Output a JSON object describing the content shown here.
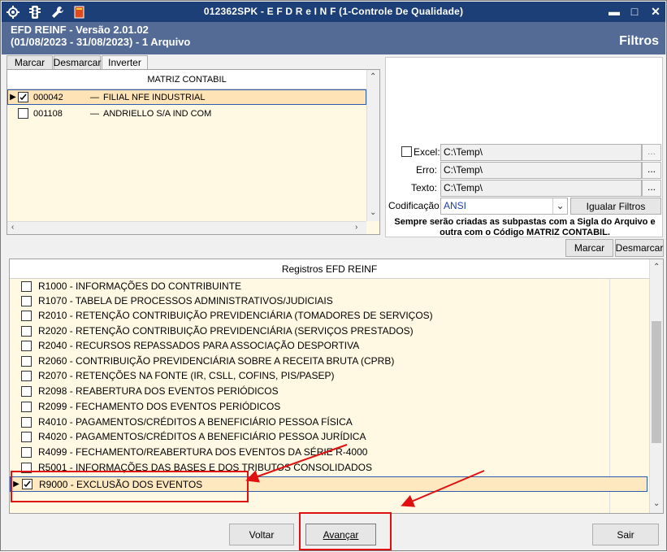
{
  "window": {
    "title": "012362SPK - E F D   R e I N F (1-Controle De Qualidade)",
    "minimize": "▬",
    "maximize": "□",
    "close": "✕"
  },
  "header": {
    "line1": "EFD REINF - Versão 2.01.02",
    "line2": "(01/08/2023 - 31/08/2023) - 1 Arquivo",
    "filtros": "Filtros"
  },
  "top_toolbar": {
    "marcar": "Marcar",
    "desmarcar": "Desmarcar",
    "inverter": "Inverter"
  },
  "matriz_grid": {
    "header": "MATRIZ CONTABIL",
    "rows": [
      {
        "checked": true,
        "code": "000042",
        "dash": "—",
        "name": "FILIAL NFE INDUSTRIAL",
        "selected": true
      },
      {
        "checked": false,
        "code": "001108",
        "dash": "—",
        "name": "ANDRIELLO S/A IND COM",
        "selected": false
      }
    ]
  },
  "settings": {
    "excel_label": "Excel:",
    "excel_value": "C:\\Temp\\",
    "excel_checked": false,
    "erro_label": "Erro:",
    "erro_value": "C:\\Temp\\",
    "texto_label": "Texto:",
    "texto_value": "C:\\Temp\\",
    "codificacao_label": "Codificação:",
    "codificacao_value": "ANSI",
    "ellipsis": "...",
    "igualar": "Igualar Filtros",
    "note_line1": "Sempre serão criadas as subpastas com a Sigla do Arquivo e",
    "note_line2": "outra com o Código MATRIZ CONTABIL."
  },
  "bottom_toolbar": {
    "marcar": "Marcar",
    "desmarcar": "Desmarcar"
  },
  "registros_grid": {
    "header": "Registros EFD REINF",
    "rows": [
      {
        "checked": false,
        "label": "R1000 - INFORMAÇÕES DO CONTRIBUINTE"
      },
      {
        "checked": false,
        "label": "R1070 - TABELA DE PROCESSOS ADMINISTRATIVOS/JUDICIAIS"
      },
      {
        "checked": false,
        "label": "R2010 - RETENÇÃO CONTRIBUIÇÃO PREVIDENCIÁRIA (TOMADORES DE SERVIÇOS)"
      },
      {
        "checked": false,
        "label": "R2020 - RETENÇÃO CONTRIBUIÇÃO PREVIDENCIÁRIA (SERVIÇOS PRESTADOS)"
      },
      {
        "checked": false,
        "label": "R2040 - RECURSOS REPASSADOS PARA ASSOCIAÇÃO DESPORTIVA"
      },
      {
        "checked": false,
        "label": "R2060 - CONTRIBUIÇÃO PREVIDENCIÁRIA SOBRE A RECEITA BRUTA (CPRB)"
      },
      {
        "checked": false,
        "label": "R2070 - RETENÇÕES NA FONTE (IR, CSLL, COFINS, PIS/PASEP)"
      },
      {
        "checked": false,
        "label": "R2098 - REABERTURA DOS EVENTOS PERIÓDICOS"
      },
      {
        "checked": false,
        "label": "R2099 - FECHAMENTO DOS EVENTOS PERIÓDICOS"
      },
      {
        "checked": false,
        "label": "R4010 - PAGAMENTOS/CRÉDITOS A BENEFICIÁRIO PESSOA FÍSICA"
      },
      {
        "checked": false,
        "label": "R4020 - PAGAMENTOS/CRÉDITOS A BENEFICIÁRIO PESSOA JURÍDICA"
      },
      {
        "checked": false,
        "label": "R4099 - FECHAMENTO/REABERTURA DOS EVENTOS DA SÉRIE R-4000"
      },
      {
        "checked": false,
        "label": "R5001 - INFORMAÇÕES DAS BASES E DOS TRIBUTOS CONSOLIDADOS"
      },
      {
        "checked": true,
        "label": "R9000 - EXCLUSÃO DOS EVENTOS",
        "selected": true
      }
    ]
  },
  "footer": {
    "voltar": "Voltar",
    "avancar": "Avançar",
    "sair": "Sair"
  },
  "colors": {
    "titlebar": "#1c3f78",
    "header": "#546c95",
    "grid_bg": "#fff8e3",
    "annotation": "#e01010"
  }
}
